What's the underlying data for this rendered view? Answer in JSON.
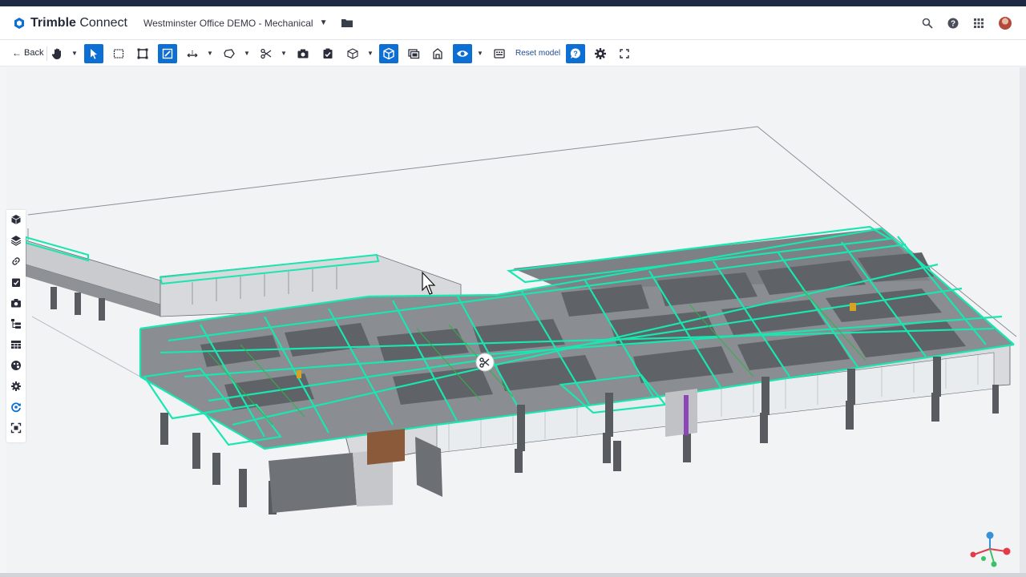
{
  "app": {
    "brand_bold": "Trimble",
    "brand_rest": " Connect",
    "project_name": "Westminster Office DEMO - Mechanical"
  },
  "toolbar": {
    "back_label": "Back",
    "reset_label": "Reset model"
  },
  "header_icons": [
    "search-icon",
    "help-icon",
    "apps-grid-icon",
    "user-avatar"
  ],
  "side_tools": [
    "cube-icon",
    "layers-icon",
    "link-icon",
    "todo-icon",
    "camera-icon",
    "tree-icon",
    "table-icon",
    "palette-icon",
    "settings-cog-icon",
    "sync-icon",
    "focus-icon"
  ],
  "colors": {
    "accent": "#0d6fd3",
    "header_dark": "#1e2a44",
    "selection_highlight": "#19e6b0"
  }
}
